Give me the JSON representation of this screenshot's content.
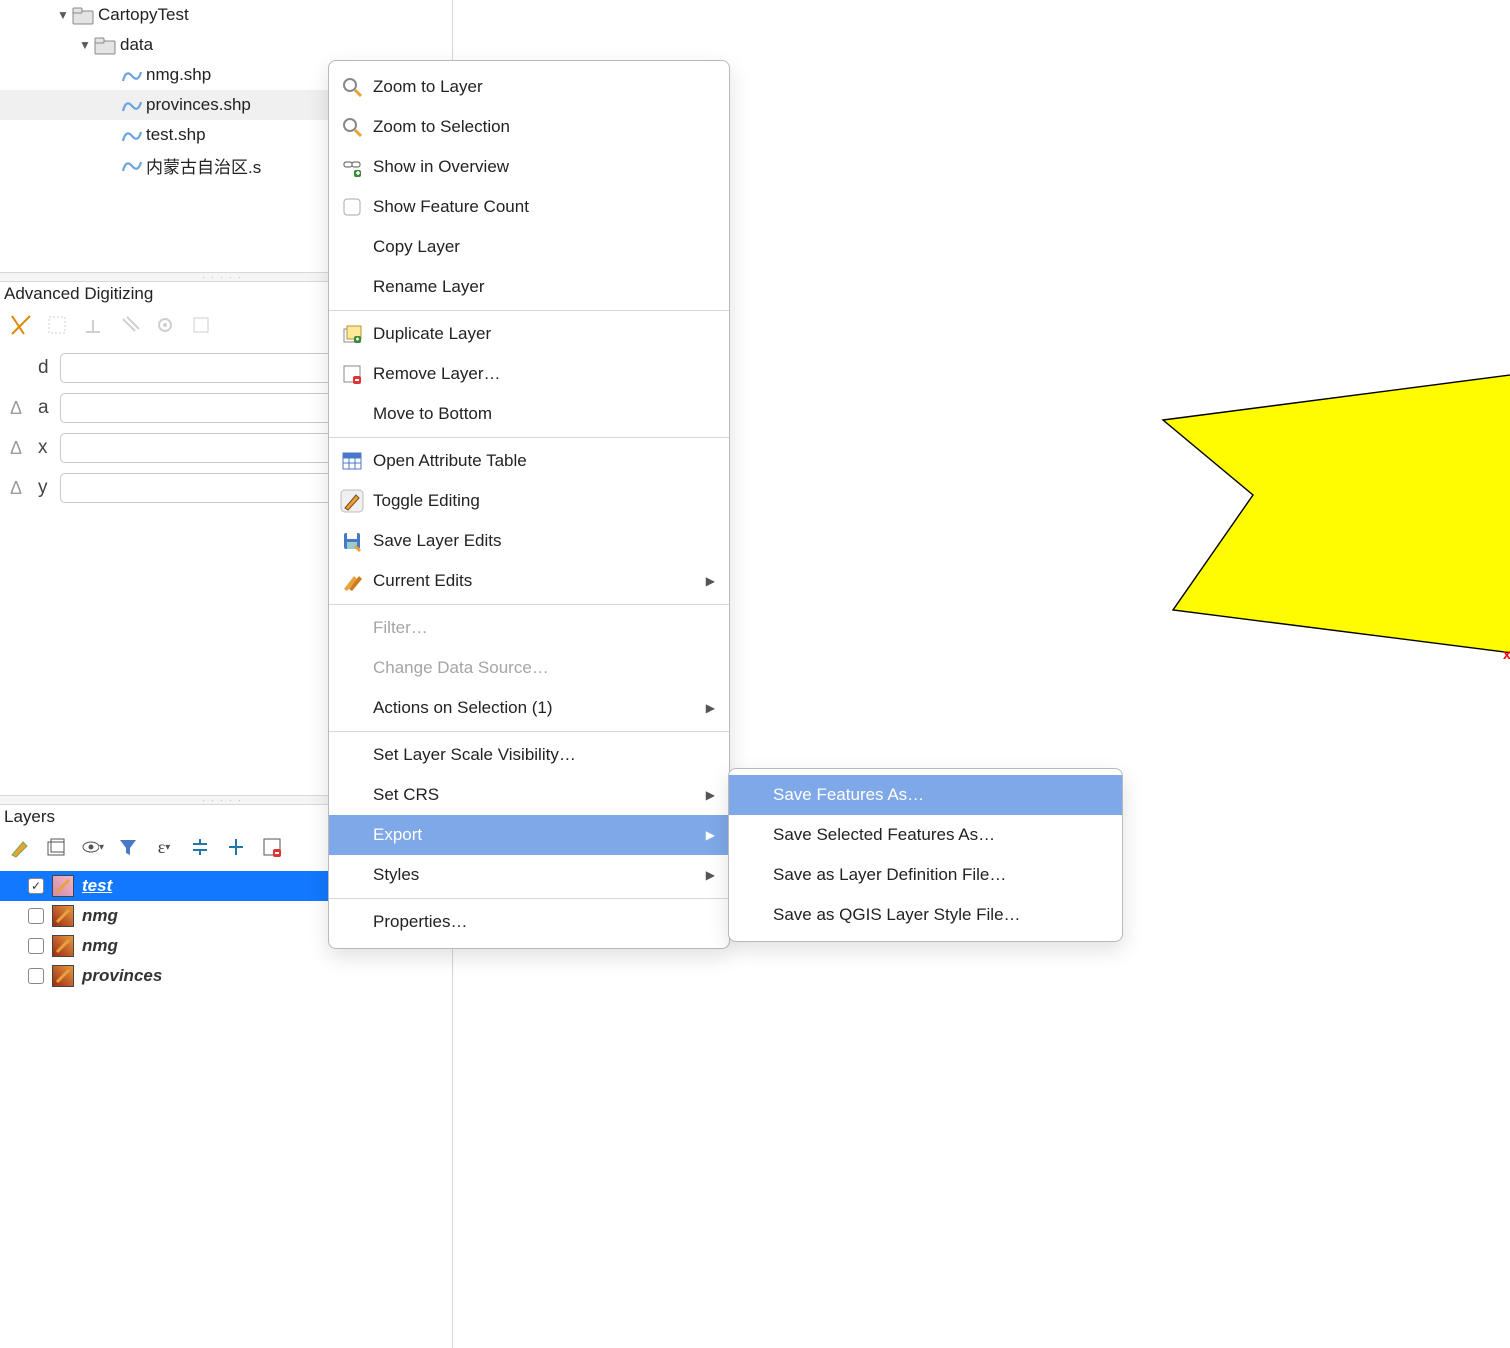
{
  "browser": {
    "root": "CartopyTest",
    "folder": "data",
    "files": [
      "nmg.shp",
      "provinces.shp",
      "test.shp",
      "内蒙古自治区.s"
    ],
    "selected_index": 1
  },
  "adv_panel": {
    "title": "Advanced Digitizing",
    "rows": [
      {
        "sym": "",
        "lab": "d",
        "value": ""
      },
      {
        "sym": "Δ",
        "lab": "a",
        "value": ""
      },
      {
        "sym": "Δ",
        "lab": "x",
        "value": ""
      },
      {
        "sym": "Δ",
        "lab": "y",
        "value": ""
      }
    ]
  },
  "layers_panel": {
    "title": "Layers",
    "items": [
      {
        "name": "test",
        "checked": true,
        "selected": true,
        "swatch": "pink"
      },
      {
        "name": "nmg",
        "checked": false,
        "selected": false,
        "swatch": "brown"
      },
      {
        "name": "nmg",
        "checked": false,
        "selected": false,
        "swatch": "brown"
      },
      {
        "name": "provinces",
        "checked": false,
        "selected": false,
        "swatch": "brown"
      }
    ]
  },
  "context_menu": {
    "items": [
      {
        "label": "Zoom to Layer",
        "icon": "zoom"
      },
      {
        "label": "Zoom to Selection",
        "icon": "zoom"
      },
      {
        "label": "Show in Overview",
        "icon": "eye"
      },
      {
        "label": "Show Feature Count",
        "icon": "checkbox"
      },
      {
        "label": "Copy Layer",
        "icon": ""
      },
      {
        "label": "Rename Layer",
        "icon": ""
      },
      {
        "sep": true
      },
      {
        "label": "Duplicate Layer",
        "icon": "dup"
      },
      {
        "label": "Remove Layer…",
        "icon": "remove"
      },
      {
        "label": "Move to Bottom",
        "icon": ""
      },
      {
        "sep": true
      },
      {
        "label": "Open Attribute Table",
        "icon": "table"
      },
      {
        "label": "Toggle Editing",
        "icon": "pencil-boxed"
      },
      {
        "label": "Save Layer Edits",
        "icon": "save"
      },
      {
        "label": "Current Edits",
        "icon": "pencils",
        "submenu": true
      },
      {
        "sep": true
      },
      {
        "label": "Filter…",
        "icon": "",
        "disabled": true
      },
      {
        "label": "Change Data Source…",
        "icon": "",
        "disabled": true
      },
      {
        "label": "Actions on Selection (1)",
        "icon": "",
        "submenu": true
      },
      {
        "sep": true
      },
      {
        "label": "Set Layer Scale Visibility…",
        "icon": ""
      },
      {
        "label": "Set CRS",
        "icon": "",
        "submenu": true
      },
      {
        "label": "Export",
        "icon": "",
        "submenu": true,
        "hover": true
      },
      {
        "label": "Styles",
        "icon": "",
        "submenu": true
      },
      {
        "sep": true
      },
      {
        "label": "Properties…",
        "icon": ""
      }
    ]
  },
  "submenu": {
    "items": [
      {
        "label": "Save Features As…",
        "hover": true
      },
      {
        "label": "Save Selected Features As…"
      },
      {
        "label": "Save as Layer Definition File…"
      },
      {
        "label": "Save as QGIS Layer Style File…"
      }
    ]
  }
}
